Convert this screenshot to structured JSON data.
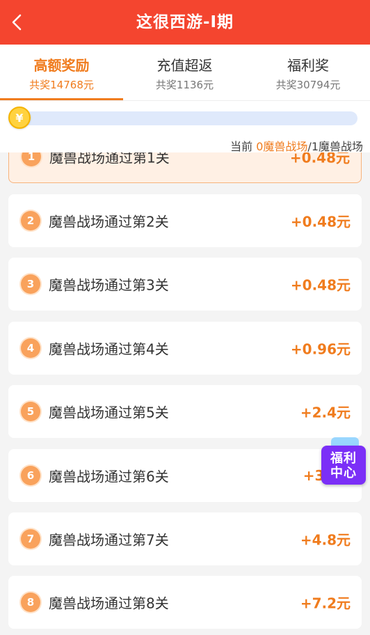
{
  "header": {
    "title": "这很西游-I期"
  },
  "tabs": [
    {
      "label": "高额奖励",
      "sub": "共奖14768元"
    },
    {
      "label": "充值超返",
      "sub": "共奖1136元"
    },
    {
      "label": "福利奖",
      "sub": "共奖30794元"
    }
  ],
  "progress": {
    "prefix": "当前 ",
    "current": "0魔兽战场",
    "suffix": "/1魔兽战场",
    "fraction": 0.0,
    "coin_glyph": "¥"
  },
  "tasks": [
    {
      "num": "1",
      "label": "魔兽战场通过第1关",
      "reward": "+0.48元"
    },
    {
      "num": "2",
      "label": "魔兽战场通过第2关",
      "reward": "+0.48元"
    },
    {
      "num": "3",
      "label": "魔兽战场通过第3关",
      "reward": "+0.48元"
    },
    {
      "num": "4",
      "label": "魔兽战场通过第4关",
      "reward": "+0.96元"
    },
    {
      "num": "5",
      "label": "魔兽战场通过第5关",
      "reward": "+2.4元"
    },
    {
      "num": "6",
      "label": "魔兽战场通过第6关",
      "reward": "+3."
    },
    {
      "num": "7",
      "label": "魔兽战场通过第7关",
      "reward": "+4.8元"
    },
    {
      "num": "8",
      "label": "魔兽战场通过第8关",
      "reward": "+7.2元"
    }
  ],
  "floating": {
    "line1": "福利",
    "line2": "中心"
  },
  "colors": {
    "header": "#f4452f",
    "accent": "#f07c1e",
    "badge": "#f9a25c",
    "welfare": "#7b2ff7"
  },
  "icons": {
    "back": "chevron-left-icon",
    "coin": "yuan-coin-icon",
    "welfare": "gift-box-icon"
  }
}
